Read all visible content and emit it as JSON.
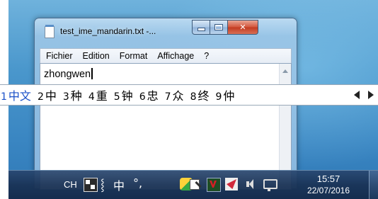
{
  "window": {
    "title": "test_ime_mandarin.txt -...",
    "buttons": {
      "minimize": "minimize",
      "maximize": "maximize",
      "close": "close"
    },
    "menu": [
      "Fichier",
      "Edition",
      "Format",
      "Affichage",
      "?"
    ]
  },
  "editor": {
    "text": "zhongwen"
  },
  "ime": {
    "candidates": [
      {
        "num": "1",
        "text": "中文",
        "selected": true
      },
      {
        "num": "2",
        "text": "中"
      },
      {
        "num": "3",
        "text": "种"
      },
      {
        "num": "4",
        "text": "重"
      },
      {
        "num": "5",
        "text": "钟"
      },
      {
        "num": "6",
        "text": "忠"
      },
      {
        "num": "7",
        "text": "众"
      },
      {
        "num": "8",
        "text": "终"
      },
      {
        "num": "9",
        "text": "仲"
      }
    ],
    "selected_color": "#1a50c8"
  },
  "taskbar": {
    "language": "CH",
    "ime_chinese_glyph": "中",
    "ime_punct_glyph": "°,",
    "ime_extra_glyph": "⸾",
    "tray_icons": [
      "ime-mode-icon",
      "shield-icon",
      "pen-icon",
      "mcafee-icon",
      "flag-icon",
      "speaker-icon",
      "network-icon"
    ],
    "clock": {
      "time": "15:57",
      "date": "22/07/2016"
    }
  }
}
